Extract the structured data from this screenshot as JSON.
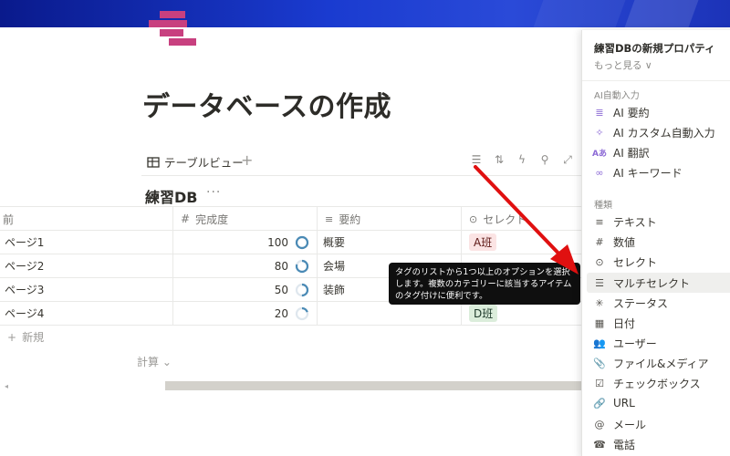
{
  "page": {
    "title": "データベースの作成"
  },
  "view": {
    "tab_label": "テーブルビュー",
    "add_label": "+"
  },
  "database": {
    "title": "練習DB",
    "more": "···"
  },
  "table": {
    "headers": [
      {
        "label": "前",
        "icon": "text-icon"
      },
      {
        "label": "完成度",
        "icon": "number-icon"
      },
      {
        "label": "要約",
        "icon": "text-lines-icon"
      },
      {
        "label": "セレクト",
        "icon": "select-icon"
      }
    ],
    "rows": [
      {
        "name": "ページ1",
        "progress": "100",
        "progress_value": 100,
        "summary": "概要",
        "tag": "A班",
        "tag_color": "#fbe4e4",
        "tag_text_color": "#5d1715"
      },
      {
        "name": "ページ2",
        "progress": "80",
        "progress_value": 80,
        "summary": "会場",
        "tag": "",
        "tag_color": "",
        "tag_text_color": ""
      },
      {
        "name": "ページ3",
        "progress": "50",
        "progress_value": 50,
        "summary": "装飾",
        "tag": "",
        "tag_color": "",
        "tag_text_color": ""
      },
      {
        "name": "ページ4",
        "progress": "20",
        "progress_value": 20,
        "summary": "",
        "tag": "D班",
        "tag_color": "#dbeddb",
        "tag_text_color": "#1c3829"
      }
    ],
    "new_row": "新規",
    "calc": "計算"
  },
  "tooltip": {
    "text": "タグのリストから1つ以上のオプションを選択します。複数のカテゴリーに該当するアイテムのタグ付けに便利です。"
  },
  "panel": {
    "title": "練習DBの新規プロパティ",
    "more": "もっと見る ∨",
    "ai_section": "AI自動入力",
    "ai_items": [
      {
        "label": "AI 要約",
        "icon": "ai-summary-icon"
      },
      {
        "label": "AI カスタム自動入力",
        "icon": "ai-sparkle-icon"
      },
      {
        "label": "AI 翻訳",
        "icon": "ai-translate-icon"
      },
      {
        "label": "AI キーワード",
        "icon": "ai-keyword-icon"
      }
    ],
    "type_section": "種類",
    "type_items": [
      {
        "label": "テキスト",
        "icon": "text-lines-icon"
      },
      {
        "label": "数値",
        "icon": "number-icon"
      },
      {
        "label": "セレクト",
        "icon": "select-icon"
      },
      {
        "label": "マルチセレクト",
        "icon": "multi-select-icon"
      },
      {
        "label": "ステータス",
        "icon": "status-icon"
      },
      {
        "label": "日付",
        "icon": "calendar-icon"
      },
      {
        "label": "ユーザー",
        "icon": "users-icon"
      },
      {
        "label": "ファイル&メディア",
        "icon": "paperclip-icon"
      },
      {
        "label": "チェックボックス",
        "icon": "checkbox-icon"
      },
      {
        "label": "URL",
        "icon": "link-icon"
      },
      {
        "label": "メール",
        "icon": "at-icon"
      },
      {
        "label": "電話",
        "icon": "phone-icon"
      }
    ]
  },
  "colors": {
    "accent_ring": "#4a8ab5",
    "arrow": "#e01010",
    "page_icon": "#c8407f",
    "cover": "#1a3bd0"
  }
}
